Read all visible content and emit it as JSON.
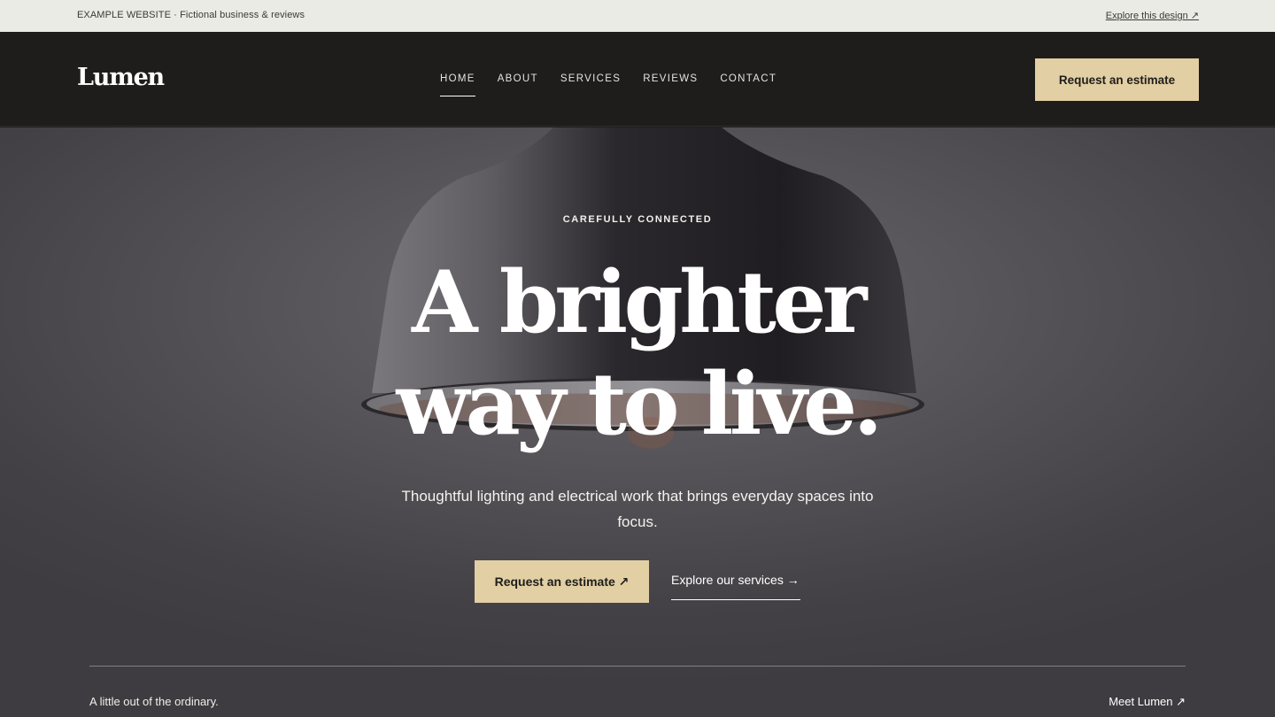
{
  "topbar": {
    "note": "EXAMPLE WEBSITE · Fictional business & reviews",
    "link": "Explore this design ↗"
  },
  "header": {
    "logo": "Lumen",
    "nav": [
      "HOME",
      "ABOUT",
      "SERVICES",
      "REVIEWS",
      "CONTACT"
    ],
    "active_nav": "HOME",
    "cta": "Request an estimate"
  },
  "hero": {
    "eyebrow": "CAREFULLY CONNECTED",
    "headline_line1": "A brighter",
    "headline_line2": "way to live.",
    "subtext": "Thoughtful lighting and electrical work that brings everyday spaces into focus.",
    "primary_button": "Request an estimate ↗",
    "secondary_link": "Explore our services →"
  },
  "footer_strip": {
    "left": "A little out of the ordinary.",
    "right": "Meet Lumen ↗"
  },
  "colors": {
    "accent": "#e2cfa4",
    "header_bg": "#1e1d1b",
    "topbar_bg": "#ebebe6"
  }
}
